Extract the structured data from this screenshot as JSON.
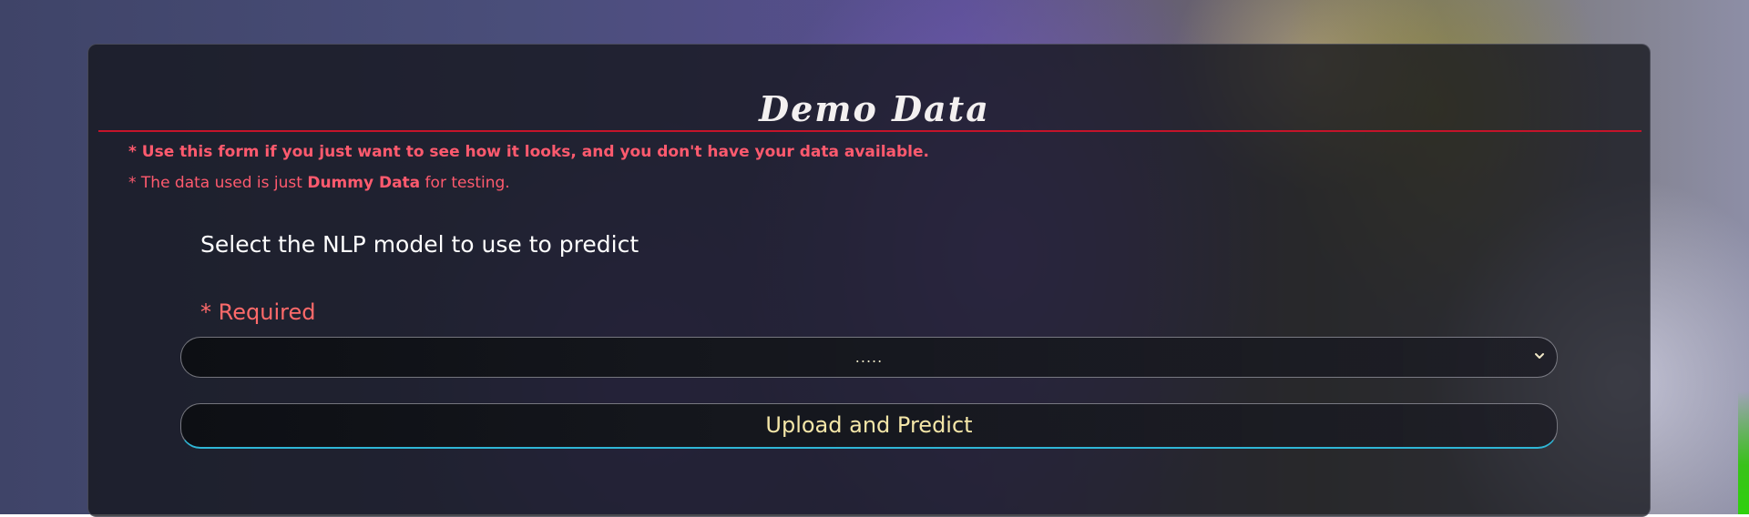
{
  "page": {
    "title": "Demo Data"
  },
  "notes": {
    "line1": "* Use this form if you just want to see how it looks, and you don't have your data available.",
    "line2_prefix": "* The data used is just ",
    "line2_bold": "Dummy Data",
    "line2_suffix": " for testing."
  },
  "form": {
    "model_label": "Select the NLP model to use to predict",
    "required_label": "* Required",
    "model_select": {
      "selected": "....."
    },
    "submit_label": "Upload and Predict"
  },
  "colors": {
    "accent_red": "#c4142a",
    "note_red": "#ff5a6e",
    "button_text": "#f4e6a8",
    "button_underline": "#2fb6d6"
  },
  "icons": {
    "select_arrow": "chevron-down-icon"
  }
}
